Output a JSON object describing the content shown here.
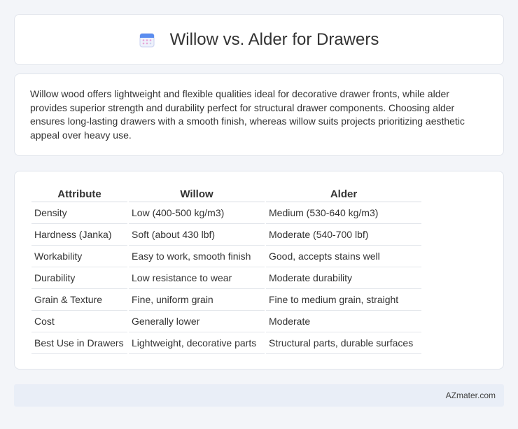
{
  "header": {
    "title": "Willow vs. Alder for Drawers",
    "icon": "calendar-icon"
  },
  "description": "Willow wood offers lightweight and flexible qualities ideal for decorative drawer fronts, while alder provides superior strength and durability perfect for structural drawer components. Choosing alder ensures long-lasting drawers with a smooth finish, whereas willow suits projects prioritizing aesthetic appeal over heavy use.",
  "table": {
    "headers": [
      "Attribute",
      "Willow",
      "Alder"
    ],
    "rows": [
      [
        "Density",
        "Low (400-500 kg/m3)",
        "Medium (530-640 kg/m3)"
      ],
      [
        "Hardness (Janka)",
        "Soft (about 430 lbf)",
        "Moderate (540-700 lbf)"
      ],
      [
        "Workability",
        "Easy to work, smooth finish",
        "Good, accepts stains well"
      ],
      [
        "Durability",
        "Low resistance to wear",
        "Moderate durability"
      ],
      [
        "Grain & Texture",
        "Fine, uniform grain",
        "Fine to medium grain, straight"
      ],
      [
        "Cost",
        "Generally lower",
        "Moderate"
      ],
      [
        "Best Use in Drawers",
        "Lightweight, decorative parts",
        "Structural parts, durable surfaces"
      ]
    ]
  },
  "footer": {
    "brand": "AZmater.com"
  },
  "colors": {
    "accent": "#5b8def",
    "icon_pink": "#e7a6d8",
    "footer_bg": "#e9eef7"
  }
}
